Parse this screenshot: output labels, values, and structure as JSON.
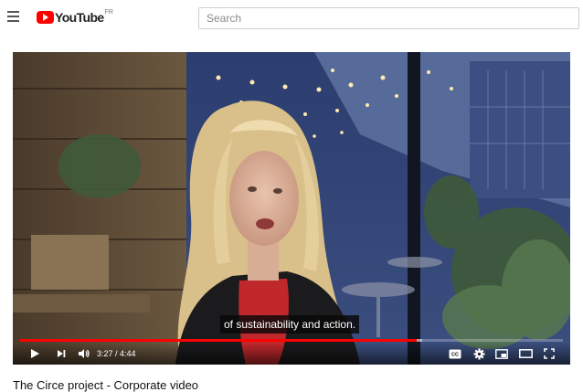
{
  "header": {
    "logo_text": "YouTube",
    "logo_region": "FR",
    "search_placeholder": "Search"
  },
  "player": {
    "subtitle": "of sustainability and action.",
    "time_current": "3:27",
    "time_total": "4:44",
    "time_display": "3:27 / 4:44",
    "progress_played_fraction": 0.73,
    "progress_loaded_fraction": 0.74,
    "progress_color": "#ff0000",
    "icons": [
      "play-icon",
      "next-icon",
      "volume-icon",
      "captions-icon",
      "settings-icon",
      "miniplayer-icon",
      "theater-mode-icon",
      "fullscreen-icon"
    ]
  },
  "video": {
    "title": "The Circe project - Corporate video"
  },
  "colors": {
    "brand_red": "#ff0000",
    "text": "#111111"
  }
}
